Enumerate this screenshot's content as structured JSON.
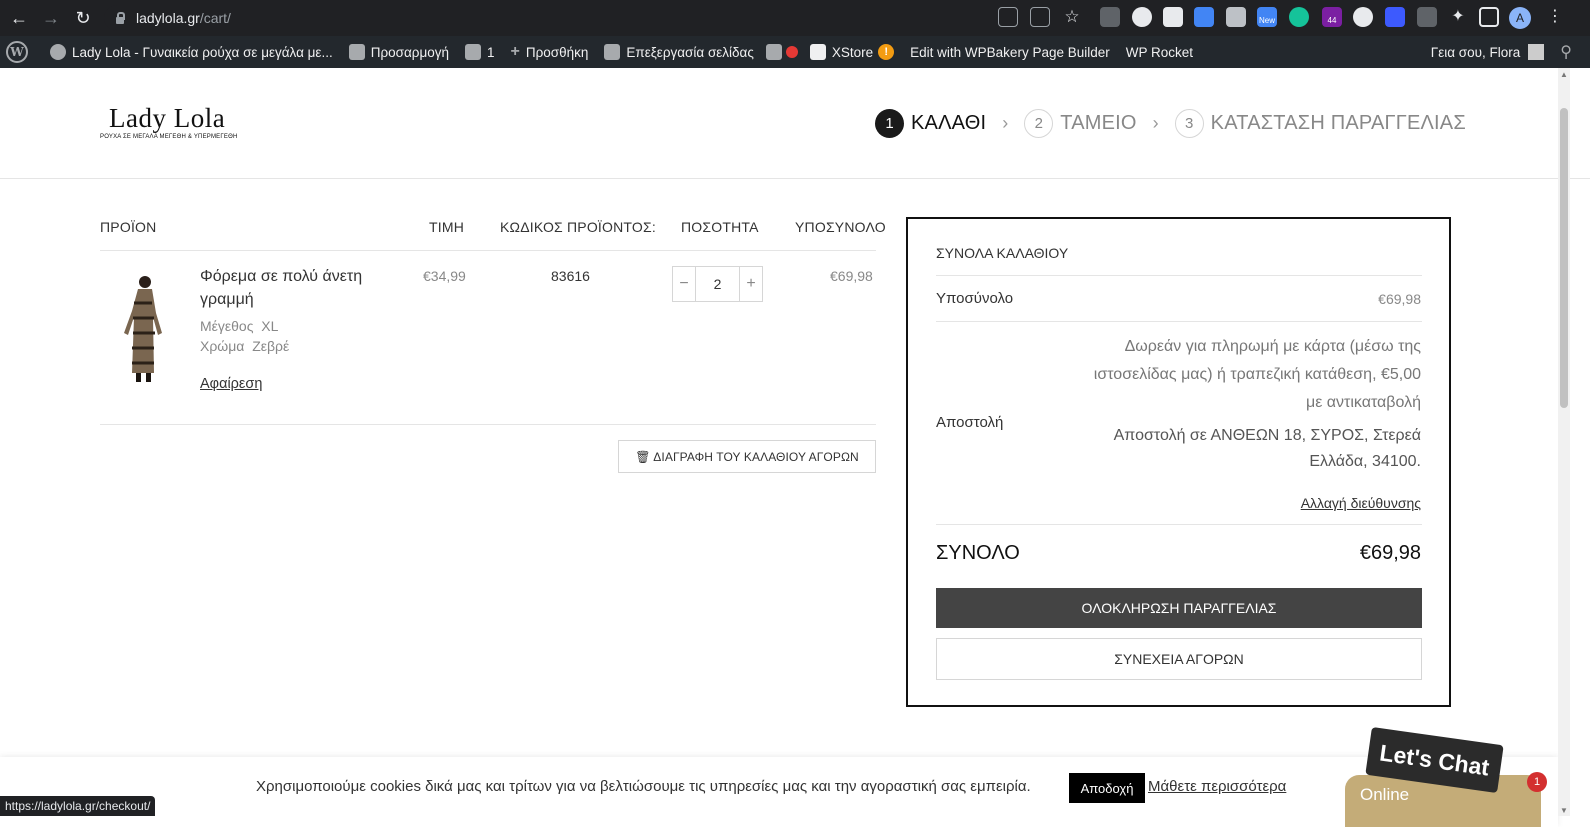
{
  "browser": {
    "url_domain": "ladylola.gr",
    "url_path": "/cart/",
    "profile_initial": "A",
    "status_url": "https://ladylola.gr/checkout/",
    "ext_new_badge": "New",
    "ext_count_badge": "44"
  },
  "admin_bar": {
    "site_name": "Lady Lola - Γυναικεία ρούχα σε μεγάλα με...",
    "customize": "Προσαρμογή",
    "comments_count": "1",
    "add_new": "Προσθήκη",
    "edit_page": "Επεξεργασία σελίδας",
    "xstore": "XStore",
    "wpbakery": "Edit with WPBakery Page Builder",
    "wp_rocket": "WP Rocket",
    "greeting": "Γεια σου, Flora"
  },
  "header": {
    "logo_title": "Lady Lola",
    "logo_tagline": "ΡΟΥΧΑ ΣΕ ΜΕΓΑΛΑ ΜΕΓΕΘΗ & ΥΠΕΡΜΕΓΕΘΗ",
    "steps": [
      {
        "num": "1",
        "label": "ΚΑΛΑΘΙ"
      },
      {
        "num": "2",
        "label": "ΤΑΜΕΙΟ"
      },
      {
        "num": "3",
        "label": "ΚΑΤΑΣΤΑΣΗ ΠΑΡΑΓΓΕΛΙΑΣ"
      }
    ]
  },
  "cart": {
    "columns": {
      "product": "ΠΡΟΪΟΝ",
      "price": "ΤΙΜΗ",
      "sku": "ΚΩΔΙΚΟΣ ΠΡΟΪΟΝΤΟΣ:",
      "quantity": "ΠΟΣΟΤΗΤΑ",
      "subtotal": "ΥΠΟΣΥΝΟΛΟ"
    },
    "items": [
      {
        "name": "Φόρεμα σε πολύ άνετη γραμμή",
        "size_label": "Μέγεθος",
        "size_value": "XL",
        "color_label": "Χρώμα",
        "color_value": "Ζεβρέ",
        "remove": "Αφαίρεση",
        "price": "€34,99",
        "sku": "83616",
        "quantity": "2",
        "subtotal": "€69,98"
      }
    ],
    "clear_cart": "🗑 ΔΙΑΓΡΑΦΗ ΤΟΥ ΚΑΛΑΘΙΟΥ ΑΓΟΡΩΝ"
  },
  "totals": {
    "title": "ΣΥΝΟΛΑ ΚΑΛΑΘΙΟΥ",
    "subtotal_label": "Υποσύνολο",
    "subtotal_value": "€69,98",
    "shipping_label": "Αποστολή",
    "shipping_text": "Δωρεάν για πληρωμή με κάρτα (μέσω της ιστοσελίδας μας) ή τραπεζική κατάθεση, €5,00 με αντικαταβολή",
    "shipping_address": "Αποστολή σε ΑΝΘΕΩΝ 18, ΣΥΡΟΣ, Στερεά Ελλάδα, 34100.",
    "change_address": "Αλλαγή διεύθυνσης",
    "total_label": "ΣΥΝΟΛΟ",
    "total_value": "€69,98",
    "checkout_button": "ΟΛΟΚΛΗΡΩΣΗ ΠΑΡΑΓΓΕΛΙΑΣ",
    "continue_button": "ΣΥΝΕΧΕΙΑ ΑΓΟΡΩΝ"
  },
  "cookie_bar": {
    "text": "Χρησιμοποιούμε cookies δικά μας και τρίτων για να βελτιώσουμε τις υπηρεσίες μας και την αγοραστική σας εμπειρία.",
    "accept": "Αποδοχή",
    "more": "Μάθετε περισσότερα"
  },
  "chat": {
    "bubble": "Let's Chat",
    "status": "Online",
    "badge": "1"
  },
  "colors": {
    "chrome_bg": "#202124",
    "admin_bar_bg": "#23282d",
    "checkout_button_bg": "#444444",
    "chat_tab_bg": "#c4ac78",
    "xstore_badge": "#f39c12",
    "record_dot": "#e53935"
  }
}
